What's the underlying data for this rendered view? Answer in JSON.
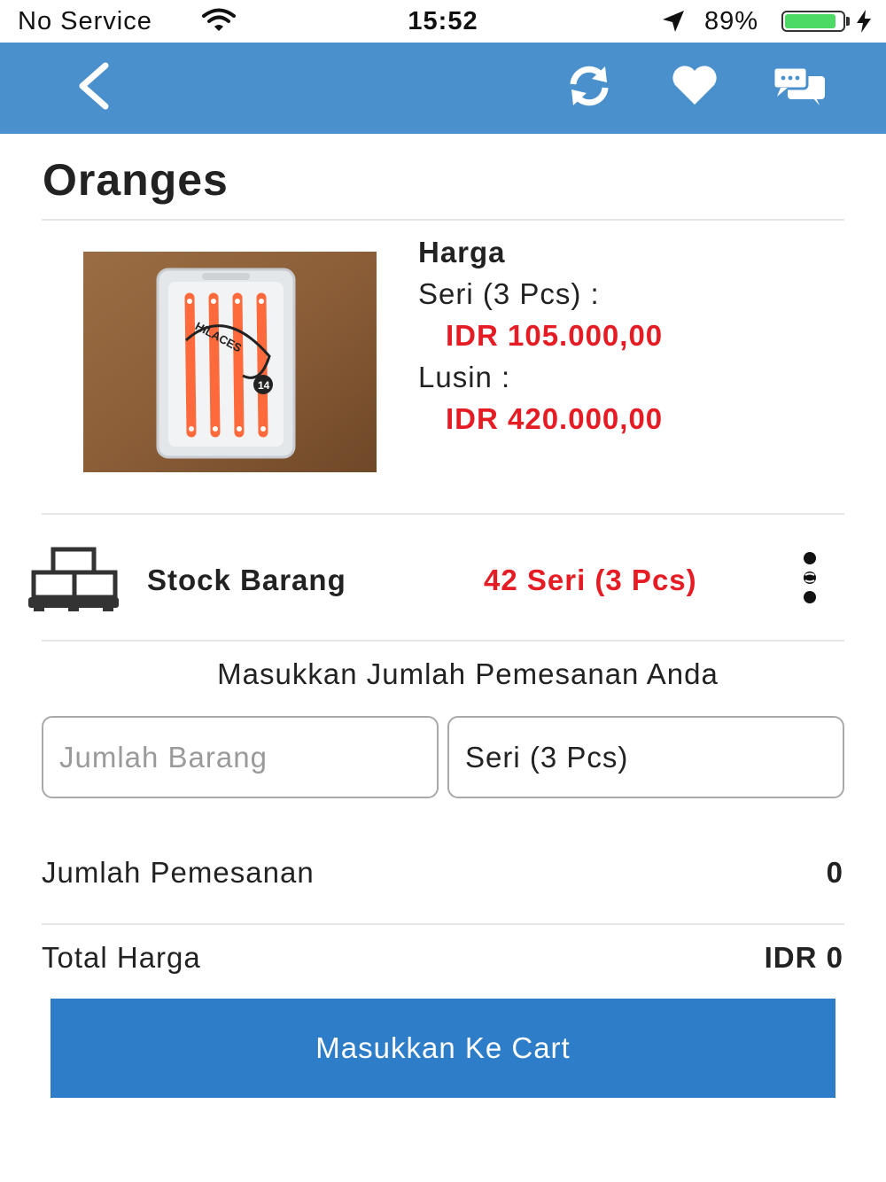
{
  "status_bar": {
    "carrier": "No Service",
    "time": "15:52",
    "battery_percent": "89%",
    "battery_level": 0.89
  },
  "nav": {
    "back_icon": "chevron-left-icon",
    "refresh_icon": "refresh-icon",
    "favorite_icon": "heart-icon",
    "chat_icon": "chat-bubbles-icon",
    "background_color": "#4a90cc"
  },
  "product": {
    "name": "Oranges",
    "image_label": "HILACES",
    "image_badge": "14"
  },
  "pricing": {
    "heading": "Harga",
    "tiers": [
      {
        "label": "Seri (3 Pcs)  :",
        "price": "IDR 105.000,00"
      },
      {
        "label": "Lusin  :",
        "price": "IDR 420.000,00"
      }
    ],
    "price_color": "#e51c23"
  },
  "stock": {
    "label": "Stock Barang",
    "value": "42 Seri (3 Pcs)",
    "icon": "boxes-icon",
    "more_icon": "more-vertical-icon"
  },
  "order": {
    "prompt": "Masukkan Jumlah Pemesanan Anda",
    "quantity_placeholder": "Jumlah Barang",
    "quantity_value": "",
    "unit_selected": "Seri (3 Pcs)"
  },
  "summary": {
    "quantity_label": "Jumlah Pemesanan",
    "quantity_value": "0",
    "total_label": "Total Harga",
    "total_value": "IDR 0"
  },
  "cart_button": {
    "label": "Masukkan Ke Cart",
    "color": "#2d7dc8"
  }
}
